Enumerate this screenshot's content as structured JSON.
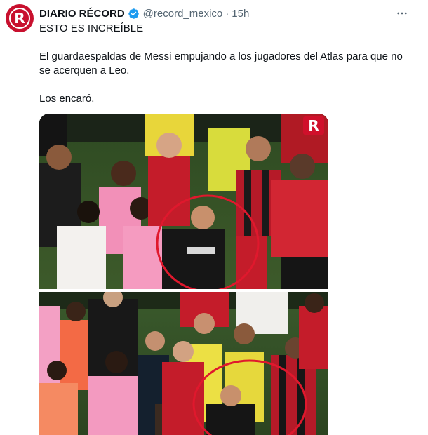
{
  "account": {
    "name": "DIARIO RÉCORD",
    "handle": "@record_mexico",
    "separator": "·",
    "time": "15h",
    "avatar_letter": "R",
    "avatar_color": "#c8102e",
    "verified_color": "#1d9bf0"
  },
  "tweet": {
    "line1": "ESTO ES INCREÍBLE",
    "line2": "El guardaespaldas de Messi empujando a los jugadores del Atlas para que no se acerquen a Leo.",
    "line3": "Los encaró."
  },
  "menu": {
    "icon": "more-horizontal-icon",
    "glyph": "···"
  },
  "media": {
    "watermark": "R",
    "highlight_color": "#e0182d",
    "photo_count": 2
  }
}
